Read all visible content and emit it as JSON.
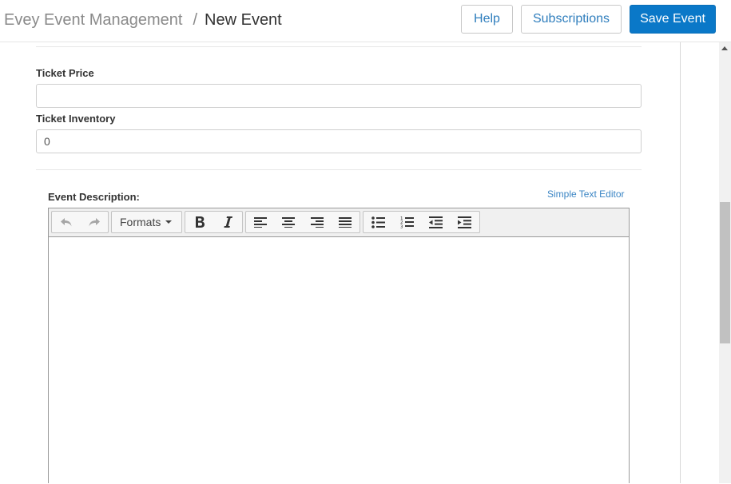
{
  "header": {
    "app_name": "Evey Event Management",
    "separator": "/",
    "page_title": "New Event",
    "buttons": {
      "help": "Help",
      "subscriptions": "Subscriptions",
      "save": "Save Event"
    }
  },
  "form": {
    "ticket_price": {
      "label": "Ticket Price",
      "value": ""
    },
    "ticket_inventory": {
      "label": "Ticket Inventory",
      "value": "0"
    },
    "event_description": {
      "label": "Event Description:",
      "simple_editor_link": "Simple Text Editor",
      "toolbar": {
        "formats_label": "Formats",
        "icons": [
          "undo-icon",
          "redo-icon",
          "bold-icon",
          "italic-icon",
          "align-left-icon",
          "align-center-icon",
          "align-right-icon",
          "align-justify-icon",
          "bullet-list-icon",
          "numbered-list-icon",
          "outdent-icon",
          "indent-icon"
        ]
      },
      "content": ""
    }
  },
  "colors": {
    "accent": "#0a78c8",
    "link": "#3a85c4"
  }
}
